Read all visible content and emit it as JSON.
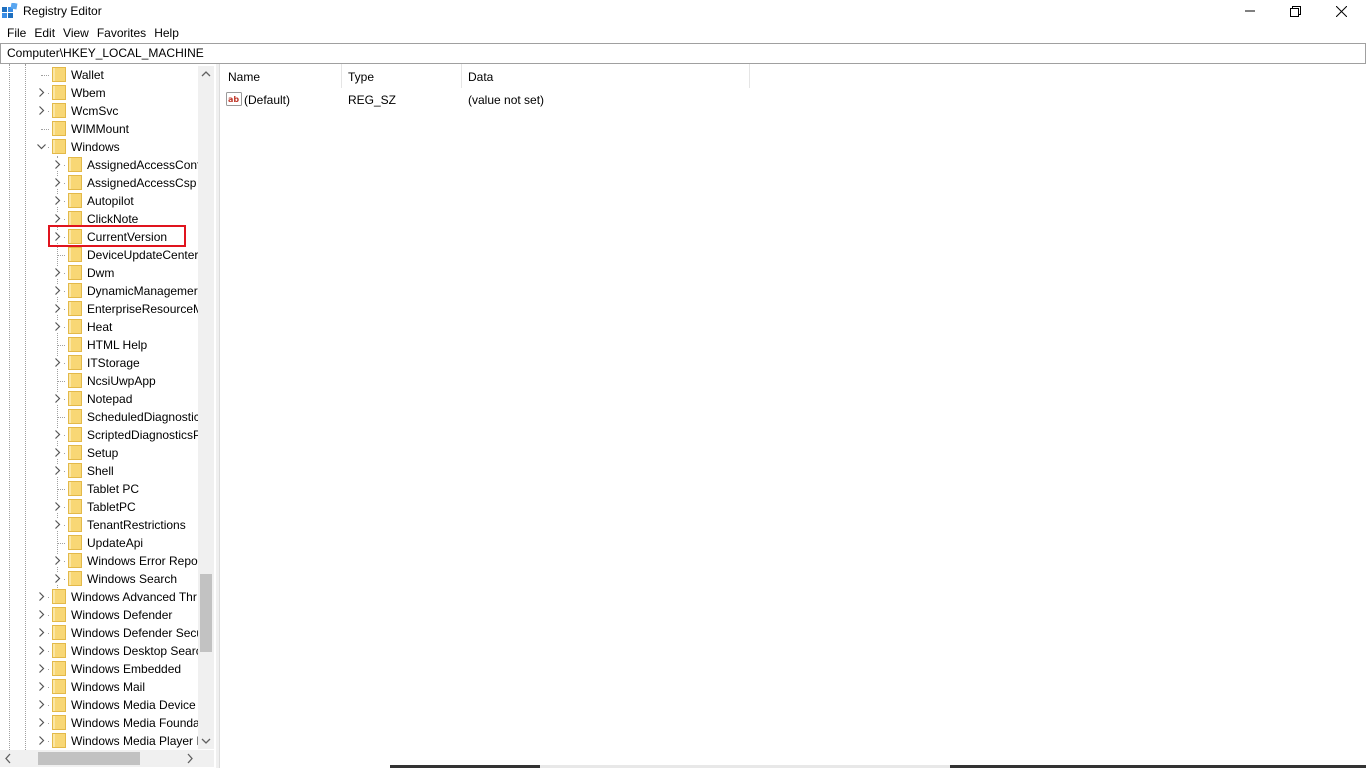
{
  "window": {
    "title": "Registry Editor",
    "icon": "registry-icon",
    "controls": [
      "minimize",
      "restore",
      "close"
    ]
  },
  "menu": [
    "File",
    "Edit",
    "View",
    "Favorites",
    "Help"
  ],
  "address": "Computer\\HKEY_LOCAL_MACHINE",
  "tree": {
    "nodes": [
      {
        "label": "Wallet",
        "level": 1,
        "expander": "none"
      },
      {
        "label": "Wbem",
        "level": 1,
        "expander": "collapsed"
      },
      {
        "label": "WcmSvc",
        "level": 1,
        "expander": "collapsed"
      },
      {
        "label": "WIMMount",
        "level": 1,
        "expander": "none"
      },
      {
        "label": "Windows",
        "level": 1,
        "expander": "expanded"
      },
      {
        "label": "AssignedAccessConf",
        "level": 2,
        "expander": "collapsed"
      },
      {
        "label": "AssignedAccessCsp",
        "level": 2,
        "expander": "collapsed"
      },
      {
        "label": "Autopilot",
        "level": 2,
        "expander": "collapsed"
      },
      {
        "label": "ClickNote",
        "level": 2,
        "expander": "collapsed"
      },
      {
        "label": "CurrentVersion",
        "level": 2,
        "expander": "collapsed",
        "highlighted": true
      },
      {
        "label": "DeviceUpdateCenter",
        "level": 2,
        "expander": "none"
      },
      {
        "label": "Dwm",
        "level": 2,
        "expander": "collapsed"
      },
      {
        "label": "DynamicManagemer",
        "level": 2,
        "expander": "collapsed"
      },
      {
        "label": "EnterpriseResourceM",
        "level": 2,
        "expander": "collapsed"
      },
      {
        "label": "Heat",
        "level": 2,
        "expander": "collapsed"
      },
      {
        "label": "HTML Help",
        "level": 2,
        "expander": "none"
      },
      {
        "label": "ITStorage",
        "level": 2,
        "expander": "collapsed"
      },
      {
        "label": "NcsiUwpApp",
        "level": 2,
        "expander": "none"
      },
      {
        "label": "Notepad",
        "level": 2,
        "expander": "collapsed"
      },
      {
        "label": "ScheduledDiagnostic",
        "level": 2,
        "expander": "none"
      },
      {
        "label": "ScriptedDiagnosticsP",
        "level": 2,
        "expander": "collapsed"
      },
      {
        "label": "Setup",
        "level": 2,
        "expander": "collapsed"
      },
      {
        "label": "Shell",
        "level": 2,
        "expander": "collapsed"
      },
      {
        "label": "Tablet PC",
        "level": 2,
        "expander": "none"
      },
      {
        "label": "TabletPC",
        "level": 2,
        "expander": "collapsed"
      },
      {
        "label": "TenantRestrictions",
        "level": 2,
        "expander": "collapsed"
      },
      {
        "label": "UpdateApi",
        "level": 2,
        "expander": "none"
      },
      {
        "label": "Windows Error Repor",
        "level": 2,
        "expander": "collapsed"
      },
      {
        "label": "Windows Search",
        "level": 2,
        "expander": "collapsed"
      },
      {
        "label": "Windows Advanced Thr",
        "level": 1,
        "expander": "collapsed"
      },
      {
        "label": "Windows Defender",
        "level": 1,
        "expander": "collapsed"
      },
      {
        "label": "Windows Defender Secu",
        "level": 1,
        "expander": "collapsed"
      },
      {
        "label": "Windows Desktop Searc",
        "level": 1,
        "expander": "collapsed"
      },
      {
        "label": "Windows Embedded",
        "level": 1,
        "expander": "collapsed"
      },
      {
        "label": "Windows Mail",
        "level": 1,
        "expander": "collapsed"
      },
      {
        "label": "Windows Media Device",
        "level": 1,
        "expander": "collapsed"
      },
      {
        "label": "Windows Media Founda",
        "level": 1,
        "expander": "collapsed"
      },
      {
        "label": "Windows Media Player I",
        "level": 1,
        "expander": "collapsed"
      }
    ]
  },
  "list": {
    "columns": [
      "Name",
      "Type",
      "Data"
    ],
    "rows": [
      {
        "name": "(Default)",
        "type": "REG_SZ",
        "data": "(value not set)",
        "icon": "string-value-icon"
      }
    ]
  },
  "colors": {
    "highlight_border": "#e0141e",
    "folder": "#f8d775"
  }
}
